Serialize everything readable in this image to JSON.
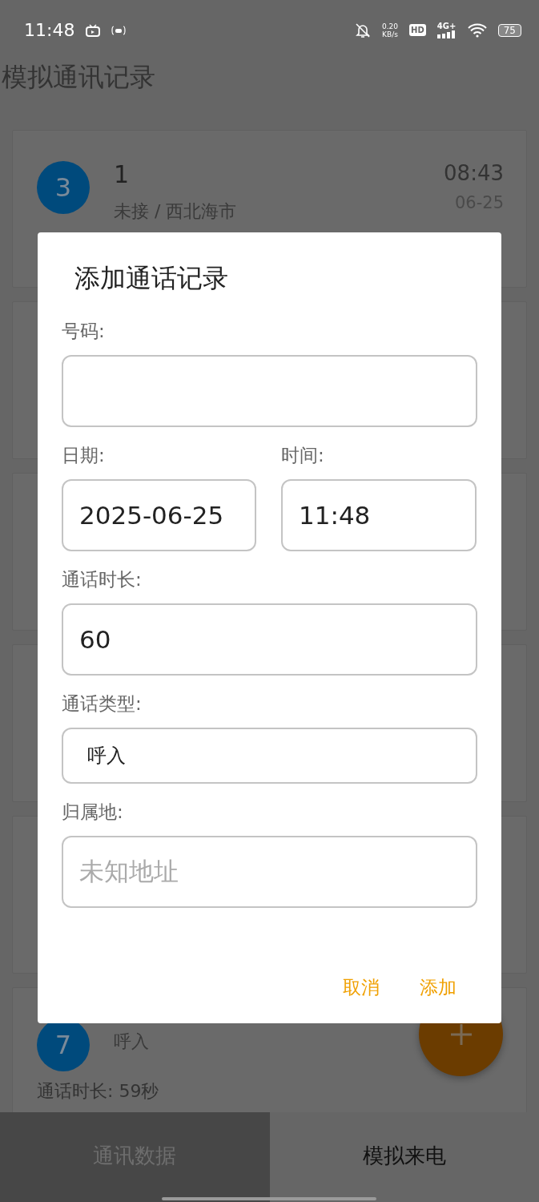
{
  "status_bar": {
    "time": "11:48",
    "net_speed": "0.20",
    "net_unit": "KB/s",
    "hd": "HD",
    "network": "4G+",
    "battery": "75"
  },
  "app_title": "模拟通讯记录",
  "records": [
    {
      "kind": "top",
      "index": "3",
      "number": "1",
      "status": "未接 / 西北海市",
      "time": "08:43",
      "date": "06-25"
    },
    {
      "kind": "covered"
    },
    {
      "kind": "covered"
    },
    {
      "kind": "covered"
    },
    {
      "kind": "covered"
    },
    {
      "kind": "bottom",
      "index": "7",
      "type": "呼入",
      "duration": "通话时长: 59秒"
    }
  ],
  "dialog": {
    "title": "添加通话记录",
    "number": {
      "label": "号码:"
    },
    "date": {
      "label": "日期:",
      "value": "2025-06-25"
    },
    "time": {
      "label": "时间:",
      "value": "11:48"
    },
    "duration": {
      "label": "通话时长:",
      "value": "60"
    },
    "call_type": {
      "label": "通话类型:",
      "value": "呼入"
    },
    "location": {
      "label": "归属地:",
      "placeholder": "未知地址"
    },
    "buttons": [
      "取消",
      "添加"
    ]
  },
  "bottom_tabs": [
    {
      "label": "通讯数据",
      "selected": false
    },
    {
      "label": "模拟来电",
      "selected": true
    }
  ]
}
